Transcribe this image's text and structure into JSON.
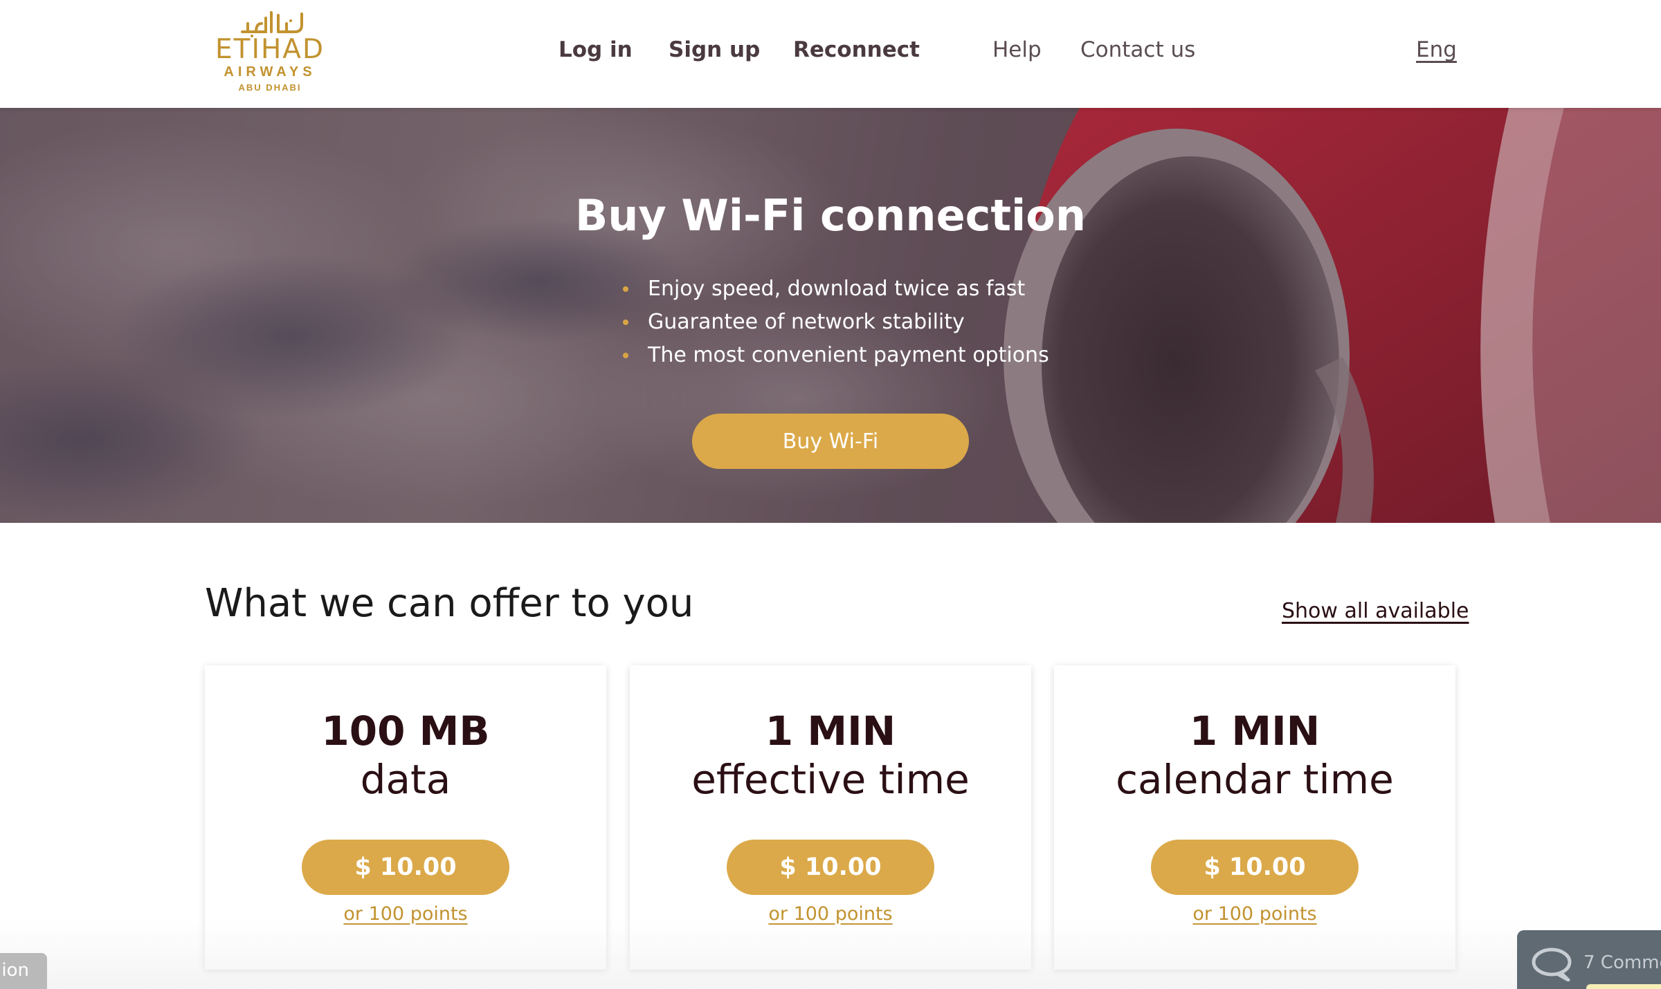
{
  "logo": {
    "arabic": "الاتحاد",
    "name": "ETIHAD",
    "line2": "AIRWAYS",
    "line3": "ABU DHABI"
  },
  "nav": {
    "login": "Log in",
    "signup": "Sign up",
    "reconnect": "Reconnect",
    "help": "Help",
    "contact": "Contact us",
    "language": "Eng"
  },
  "hero": {
    "title": "Buy Wi-Fi connection",
    "bullets": [
      "Enjoy speed, download twice as fast",
      "Guarantee of network stability",
      "The most convenient payment options"
    ],
    "button": "Buy Wi-Fi"
  },
  "offers": {
    "title": "What we can offer to you",
    "show_all": "Show all available",
    "cards": [
      {
        "amount": "100 MB",
        "unit": "data",
        "price": "$ 10.00",
        "points": "or 100 points"
      },
      {
        "amount": "1 MIN",
        "unit": "effective time",
        "price": "$ 10.00",
        "points": "or 100 points"
      },
      {
        "amount": "1 MIN",
        "unit": "calendar time",
        "price": "$ 10.00",
        "points": "or 100 points"
      }
    ]
  },
  "overlays": {
    "left_tab": "ion",
    "comments": "7 Comme"
  },
  "colors": {
    "accent": "#dba949",
    "brand_gold": "#c2922f",
    "text_dark": "#2a0f14"
  }
}
